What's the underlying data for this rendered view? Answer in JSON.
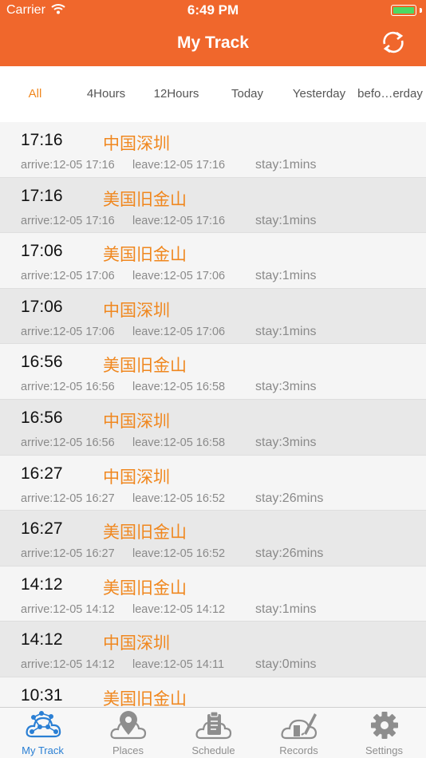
{
  "status_bar": {
    "carrier": "Carrier",
    "time": "6:49 PM"
  },
  "header": {
    "title": "My Track"
  },
  "filters": [
    "All",
    "4Hours",
    "12Hours",
    "Today",
    "Yesterday",
    "befo…erday"
  ],
  "records": [
    {
      "time": "17:16",
      "place": "中国深圳",
      "arrive": "arrive:12-05 17:16",
      "leave": "leave:12-05 17:16",
      "stay": "stay:1mins"
    },
    {
      "time": "17:16",
      "place": "美国旧金山",
      "arrive": "arrive:12-05 17:16",
      "leave": "leave:12-05 17:16",
      "stay": "stay:1mins"
    },
    {
      "time": "17:06",
      "place": "美国旧金山",
      "arrive": "arrive:12-05 17:06",
      "leave": "leave:12-05 17:06",
      "stay": "stay:1mins"
    },
    {
      "time": "17:06",
      "place": "中国深圳",
      "arrive": "arrive:12-05 17:06",
      "leave": "leave:12-05 17:06",
      "stay": "stay:1mins"
    },
    {
      "time": "16:56",
      "place": "美国旧金山",
      "arrive": "arrive:12-05 16:56",
      "leave": "leave:12-05 16:58",
      "stay": "stay:3mins"
    },
    {
      "time": "16:56",
      "place": "中国深圳",
      "arrive": "arrive:12-05 16:56",
      "leave": "leave:12-05 16:58",
      "stay": "stay:3mins"
    },
    {
      "time": "16:27",
      "place": "中国深圳",
      "arrive": "arrive:12-05 16:27",
      "leave": "leave:12-05 16:52",
      "stay": "stay:26mins"
    },
    {
      "time": "16:27",
      "place": "美国旧金山",
      "arrive": "arrive:12-05 16:27",
      "leave": "leave:12-05 16:52",
      "stay": "stay:26mins"
    },
    {
      "time": "14:12",
      "place": "美国旧金山",
      "arrive": "arrive:12-05 14:12",
      "leave": "leave:12-05 14:12",
      "stay": "stay:1mins"
    },
    {
      "time": "14:12",
      "place": "中国深圳",
      "arrive": "arrive:12-05 14:12",
      "leave": "leave:12-05 14:11",
      "stay": "stay:0mins"
    },
    {
      "time": "10:31",
      "place": "美国旧金山",
      "arrive": "",
      "leave": "",
      "stay": ""
    }
  ],
  "tabbar": [
    {
      "label": "My Track",
      "icon": "cloud-network-icon"
    },
    {
      "label": "Places",
      "icon": "location-pin-icon"
    },
    {
      "label": "Schedule",
      "icon": "clipboard-icon"
    },
    {
      "label": "Records",
      "icon": "notebook-pen-icon"
    },
    {
      "label": "Settings",
      "icon": "gear-icon"
    }
  ],
  "colors": {
    "header": "#f0672c",
    "accent": "#f0871e",
    "active_tab": "#2a7fd4"
  }
}
